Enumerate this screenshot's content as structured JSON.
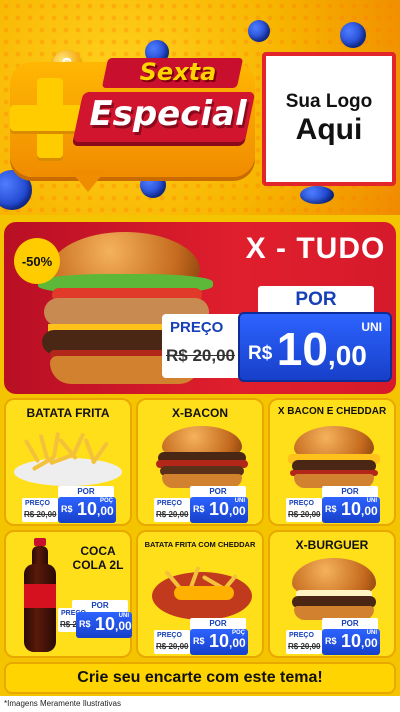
{
  "header": {
    "tagline_top": "Sexta",
    "tagline_main": "Especial",
    "plus_symbol": "+",
    "coin_symbol": "$",
    "logo_line1": "Sua Logo",
    "logo_line2": "Aqui"
  },
  "featured": {
    "discount_badge": "-50%",
    "title": "X - TUDO",
    "por_label": "POR",
    "preco_label": "PREÇO",
    "old_price": "R$ 20,00",
    "unit_label": "UNI",
    "currency": "R$",
    "price_int": "10",
    "price_cents": ",00"
  },
  "products": [
    {
      "name": "BATATA FRITA",
      "por_label": "POR",
      "preco_label": "PREÇO",
      "old_price": "R$ 20,00",
      "unit_label": "POÇ",
      "currency": "R$",
      "price_int": "10",
      "price_cents": ",00"
    },
    {
      "name": "X-BACON",
      "por_label": "POR",
      "preco_label": "PREÇO",
      "old_price": "R$ 20,00",
      "unit_label": "UNI",
      "currency": "R$",
      "price_int": "10",
      "price_cents": ",00"
    },
    {
      "name": "X BACON E CHEDDAR",
      "por_label": "POR",
      "preco_label": "PREÇO",
      "old_price": "R$ 20,00",
      "unit_label": "UNI",
      "currency": "R$",
      "price_int": "10",
      "price_cents": ",00"
    },
    {
      "name_line1": "COCA",
      "name_line2": "COLA 2L",
      "por_label": "POR",
      "preco_label": "PREÇO",
      "old_price": "R$ 20,00",
      "unit_label": "UNI",
      "currency": "R$",
      "price_int": "10",
      "price_cents": ",00"
    },
    {
      "name": "BATATA FRITA COM CHEDDAR",
      "por_label": "POR",
      "preco_label": "PREÇO",
      "old_price": "R$ 20,00",
      "unit_label": "POÇ",
      "currency": "R$",
      "price_int": "10",
      "price_cents": ",00"
    },
    {
      "name": "X-BURGUER",
      "por_label": "POR",
      "preco_label": "PREÇO",
      "old_price": "R$ 20,00",
      "unit_label": "UNI",
      "currency": "R$",
      "price_int": "10",
      "price_cents": ",00"
    }
  ],
  "cta": "Crie seu encarte com este tema!",
  "footnote": "*Imagens Meramente Ilustrativas",
  "colors": {
    "primary_red": "#d61a2b",
    "accent_yellow": "#ffd400",
    "price_blue": "#1740c9"
  }
}
